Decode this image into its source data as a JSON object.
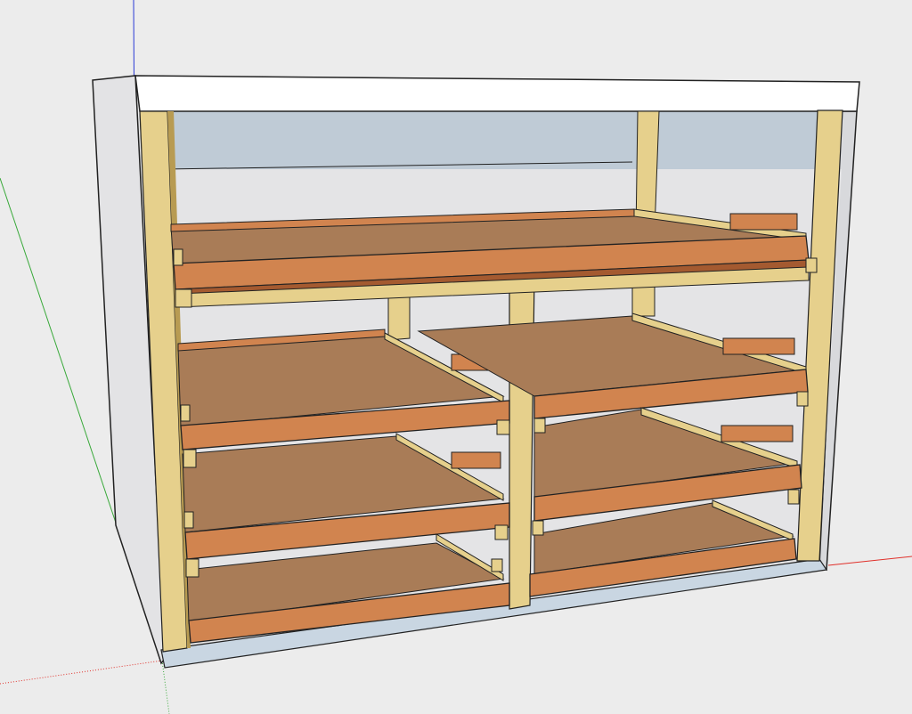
{
  "app": {
    "name": ""
  },
  "colors": {
    "background": "#ececec",
    "top_panel": "#ffffff",
    "side_panel": "#e3e3e5",
    "back_panel": "#bfcbd6",
    "wood_light": "#e6d08c",
    "wood_dark": "#b89b52",
    "drawer_front": "#d1844f",
    "drawer_front_shadow": "#a45a30",
    "drawer_bottom": "#a97c57",
    "axis_red": "#e0302a",
    "axis_green": "#39a93a",
    "axis_blue": "#2a3ad6"
  },
  "scene": {
    "model": "drawer-cabinet",
    "drawer_rows": 4,
    "drawer_columns": 2,
    "top_drawer_full_width": true
  }
}
